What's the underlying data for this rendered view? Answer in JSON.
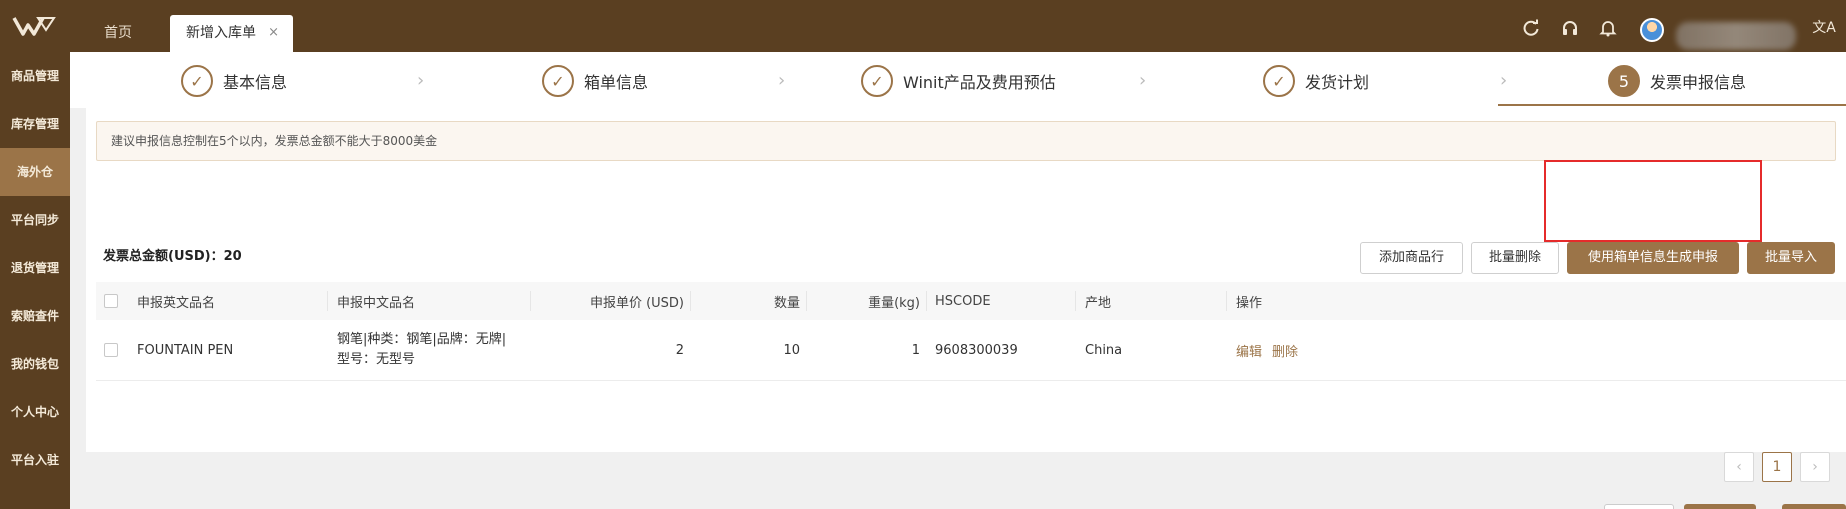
{
  "header": {
    "tabs": [
      {
        "label": "首页"
      },
      {
        "label": "新增入库单",
        "close": "×"
      }
    ],
    "icons": [
      "refresh-icon",
      "headset-icon",
      "bell-icon",
      "avatar",
      "translate-icon"
    ],
    "translate_glyph": "文A"
  },
  "sidebar": {
    "items": [
      {
        "label": "商品管理"
      },
      {
        "label": "库存管理"
      },
      {
        "label": "海外仓",
        "active": true
      },
      {
        "label": "平台同步"
      },
      {
        "label": "退货管理"
      },
      {
        "label": "索赔查件"
      },
      {
        "label": "我的钱包"
      },
      {
        "label": "个人中心"
      },
      {
        "label": "平台入驻"
      }
    ]
  },
  "steps": [
    {
      "label": "基本信息",
      "marker": "✓"
    },
    {
      "label": "箱单信息",
      "marker": "✓"
    },
    {
      "label": "Winit产品及费用预估",
      "marker": "✓"
    },
    {
      "label": "发货计划",
      "marker": "✓"
    },
    {
      "label": "发票申报信息",
      "marker": "5"
    }
  ],
  "notice": "建议申报信息控制在5个以内，发票总金额不能大于8000美金",
  "total_label": "发票总金额(USD)：20",
  "buttons": {
    "add_row": "添加商品行",
    "batch_delete": "批量删除",
    "generate": "使用箱单信息生成申报",
    "batch_import": "批量导入"
  },
  "table": {
    "headers": [
      "申报英文品名",
      "申报中文品名",
      "申报单价 (USD)",
      "数量",
      "重量(kg)",
      "HSCODE",
      "产地",
      "操作"
    ],
    "rows": [
      {
        "en_name": "FOUNTAIN PEN",
        "cn_name_line1": "钢笔|种类：钢笔|品牌：无牌|",
        "cn_name_line2": "型号：无型号",
        "price": "2",
        "qty": "10",
        "weight": "1",
        "hscode": "9608300039",
        "origin": "China",
        "edit": "编辑",
        "delete": "删除"
      }
    ]
  },
  "pagination": {
    "prev": "‹",
    "current": "1",
    "next": "›"
  },
  "colors": {
    "brand": "#5a3f21",
    "accent": "#9b7448",
    "highlight": "#e52b2b"
  }
}
